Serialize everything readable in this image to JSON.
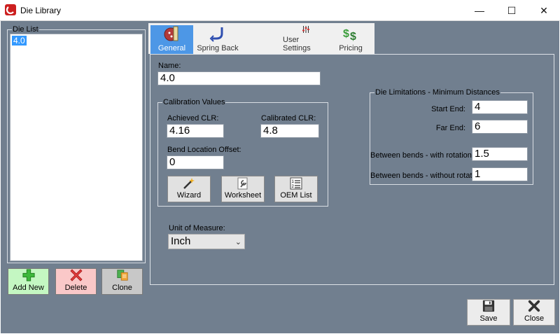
{
  "window": {
    "title": "Die Library",
    "minimize": "—",
    "maximize": "☐",
    "close": "✕"
  },
  "die_list": {
    "group_label": "Die List",
    "items": [
      "4.0"
    ]
  },
  "list_buttons": {
    "add_new": "Add New",
    "delete": "Delete",
    "clone": "Clone"
  },
  "tabs": [
    {
      "label": "General",
      "icon": "die-shape-icon",
      "active": true
    },
    {
      "label": "Spring Back",
      "icon": "bend-arrow-icon",
      "active": false
    },
    {
      "label": "User Settings",
      "icon": "sliders-icon",
      "active": false
    },
    {
      "label": "Pricing",
      "icon": "dollar-icon",
      "active": false
    }
  ],
  "general": {
    "name_label": "Name:",
    "name_value": "4.0",
    "calibration": {
      "group_label": "Calibration Values",
      "achieved_clr_label": "Achieved CLR:",
      "achieved_clr_value": "4.16",
      "calibrated_clr_label": "Calibrated CLR:",
      "calibrated_clr_value": "4.8",
      "bend_offset_label": "Bend Location Offset:",
      "bend_offset_value": "0",
      "wizard_label": "Wizard",
      "worksheet_label": "Worksheet",
      "oem_list_label": "OEM List"
    },
    "unit_label": "Unit of Measure:",
    "unit_value": "Inch",
    "limitations": {
      "group_label": "Die Limitations - Minimum Distances",
      "start_end_label": "Start End:",
      "start_end_value": "4",
      "far_end_label": "Far End:",
      "far_end_value": "6",
      "with_rotation_label": "Between bends - with rotation:",
      "with_rotation_value": "1.5",
      "without_rotation_label": "Between bends - without rotation:",
      "without_rotation_value": "1"
    }
  },
  "footer": {
    "save": "Save",
    "close": "Close"
  }
}
